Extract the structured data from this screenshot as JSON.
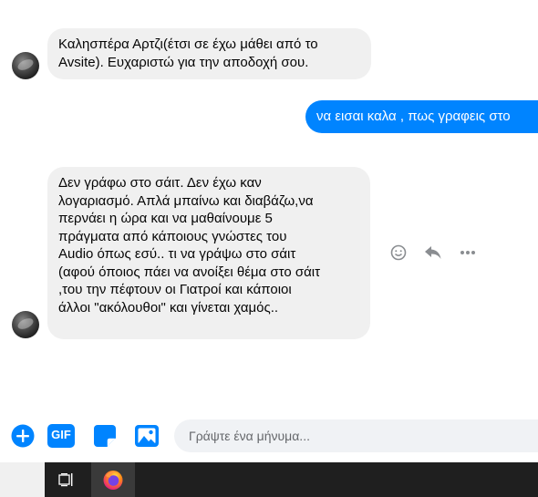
{
  "messages": [
    {
      "side": "in",
      "text": "Καλησπέρα Αρτζι(έτσι σε έχω μάθει από το\nAvsite). Ευχαριστώ για την αποδοχή σου."
    },
    {
      "side": "out",
      "text": "να εισαι καλα , πως γραφεις στο"
    },
    {
      "side": "in",
      "text": "Δεν γράφω στο σάιτ. Δεν έχω καν\nλογαριασμό. Απλά μπαίνω και διαβάζω,να\nπερνάει η ώρα και να μαθαίνουμε 5\nπράγματα από κάποιους γνώστες του\nAudio όπως εσύ.. τι να γράψω στο σάιτ\n(αφού όποιος πάει να ανοίξει θέμα στο σάιτ\n,του την πέφτουν οι Γιατροί και κάποιοι\nάλλοι \"ακόλουθοι\" και γίνεται χαμός.."
    }
  ],
  "message_actions": {
    "icons": [
      "smiley-icon",
      "reply-icon",
      "more-icon"
    ]
  },
  "composer": {
    "placeholder": "Γράψτε ένα μήνυμα...",
    "gif_label": "GIF",
    "tools": [
      "add-icon",
      "gif-icon",
      "sticker-icon",
      "photo-icon"
    ]
  },
  "taskbar": {
    "items": [
      "task-view-icon",
      "firefox-icon"
    ]
  },
  "colors": {
    "accent": "#0084ff",
    "incoming_bubble": "#f0f0f0",
    "taskbar": "#1f1f1f"
  }
}
